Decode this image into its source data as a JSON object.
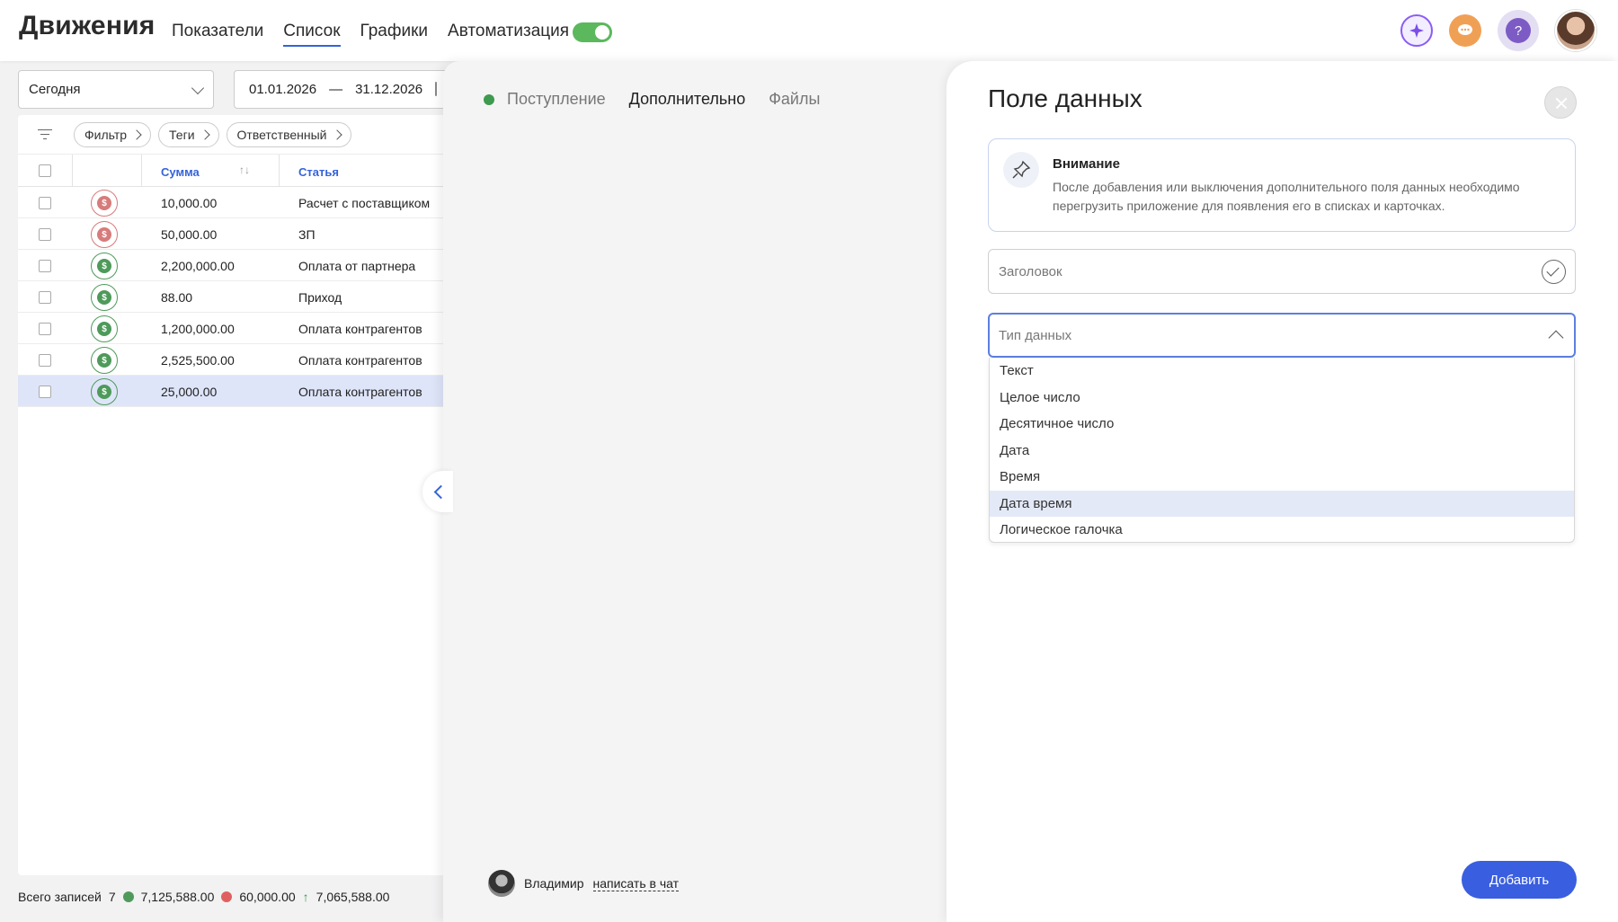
{
  "header": {
    "title": "Движения",
    "tabs": [
      {
        "label": "Показатели"
      },
      {
        "label": "Список"
      },
      {
        "label": "Графики"
      },
      {
        "label": "Автоматизация"
      }
    ],
    "help_glyph": "?"
  },
  "list": {
    "period": "Сегодня",
    "date_from": "01.01.2026",
    "date_sep": "—",
    "date_to": "31.12.2026",
    "filters": [
      "Фильтр",
      "Теги",
      "Ответственный"
    ],
    "columns": {
      "sum": "Сумма",
      "article": "Статья"
    },
    "rows": [
      {
        "type": "out",
        "sum": "10,000.00",
        "article": "Расчет с поставщиком"
      },
      {
        "type": "out",
        "sum": "50,000.00",
        "article": "ЗП"
      },
      {
        "type": "in",
        "sum": "2,200,000.00",
        "article": "Оплата от партнера"
      },
      {
        "type": "in",
        "sum": "88.00",
        "article": "Приход"
      },
      {
        "type": "in",
        "sum": "1,200,000.00",
        "article": "Оплата контрагентов"
      },
      {
        "type": "in",
        "sum": "2,525,500.00",
        "article": "Оплата контрагентов"
      },
      {
        "type": "in",
        "sum": "25,000.00",
        "article": "Оплата контрагентов"
      }
    ],
    "footer": {
      "label": "Всего записей",
      "count": "7",
      "income": "7,125,588.00",
      "expense": "60,000.00",
      "balance": "7,065,588.00"
    }
  },
  "drawer": {
    "tabs": [
      "Поступление",
      "Дополнительно",
      "Файлы"
    ],
    "contact_name": "Владимир",
    "contact_link": "написать в чат"
  },
  "modal": {
    "title": "Поле данных",
    "notice_title": "Внимание",
    "notice_text": "После добавления или выключения дополнительного поля данных необходимо перегрузить приложение для появления его в списках и карточках.",
    "title_placeholder": "Заголовок",
    "type_placeholder": "Тип данных",
    "options": [
      "Текст",
      "Целое число",
      "Десятичное число",
      "Дата",
      "Время",
      "Дата время",
      "Логическое галочка"
    ],
    "hovered_option": "Дата время",
    "add_label": "Добавить"
  },
  "colors": {
    "accent": "#3a5ee0",
    "income": "#4e9a5a",
    "expense": "#d77b7b",
    "toggle_on": "#5bb85d"
  },
  "icons": [
    "filter-icon",
    "money-icon",
    "pin-icon",
    "check-icon",
    "close-icon",
    "chevron-down-icon",
    "chevron-up-icon",
    "calendar-icon",
    "sparkle-icon",
    "chat-icon",
    "help-icon"
  ]
}
